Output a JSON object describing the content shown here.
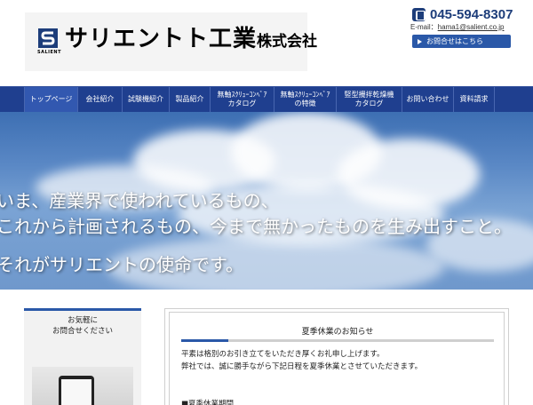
{
  "header": {
    "logo_subtext": "SALIENT",
    "company_name": "サリエントト工業",
    "company_suffix": "株式会社",
    "phone": "045-594-8307",
    "email_label": "E-mail：",
    "email": "hama1@salient.co.jp",
    "contact_button": "お問合せはこちら"
  },
  "nav": {
    "items": [
      {
        "label": "トップページ"
      },
      {
        "label": "会社紹介"
      },
      {
        "label": "試験機紹介"
      },
      {
        "label": "製品紹介"
      },
      {
        "label": "無軸ｽｸﾘｭｰｺﾝﾍﾞｱ",
        "label2": "カタログ"
      },
      {
        "label": "無軸ｽｸﾘｭｰｺﾝﾍﾞｱ",
        "label2": "の特徴"
      },
      {
        "label": "竪型攪拌乾燥機",
        "label2": "カタログ"
      },
      {
        "label": "お問い合わせ"
      },
      {
        "label": "資料請求"
      }
    ]
  },
  "hero": {
    "line1": "いま、産業界で使われているもの、",
    "line2": "これから計画されるもの、今まで無かったものを生み出すこと。",
    "line3": "それがサリエントの使命です。"
  },
  "sidebar": {
    "title_line1": "お気軽に",
    "title_line2": "お問合せください"
  },
  "news": {
    "title": "夏季休業のお知らせ",
    "body_line1": "平素は格別のお引き立てをいただき厚くお礼申し上げます。",
    "body_line2": "弊社では、誠に勝手ながら下記日程を夏季休業とさせていただきます。",
    "period_label": "■夏季休業期間"
  },
  "colors": {
    "brand_navy": "#1f3f8f",
    "accent_blue": "#2a58a8"
  }
}
